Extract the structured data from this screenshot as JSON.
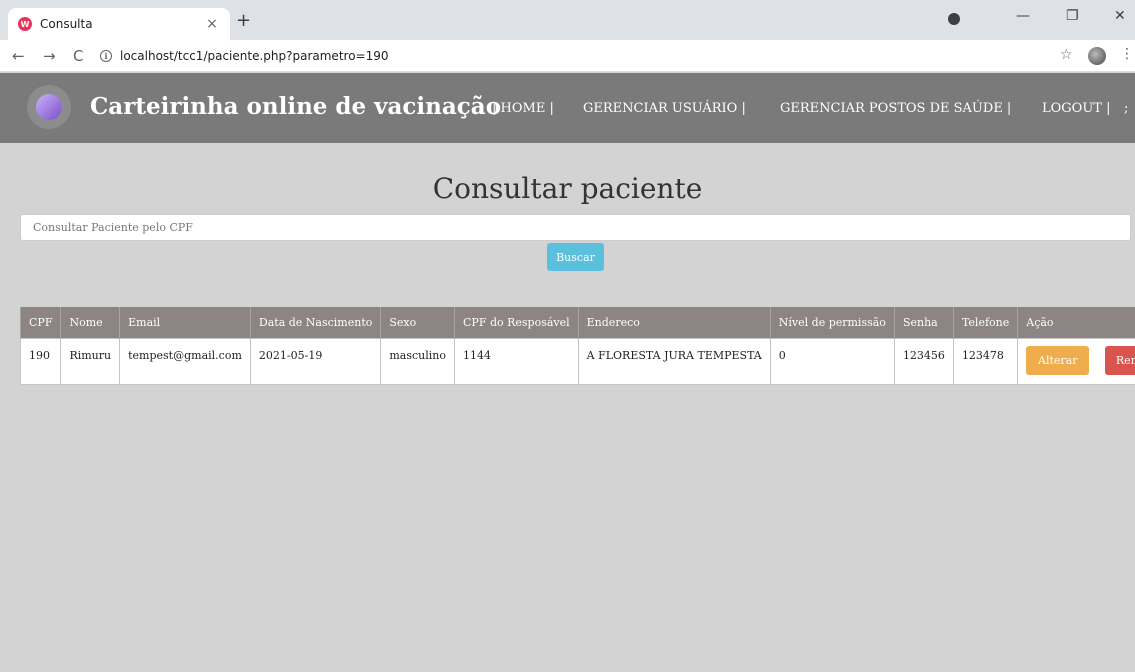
{
  "browser": {
    "tab_title": "Consulta",
    "tab_favicon_glyph": "W",
    "tab_close": "×",
    "new_tab": "+",
    "url": "localhost/tcc1/paciente.php?parametro=190",
    "back": "←",
    "forward": "→",
    "reload": "C",
    "info": "i",
    "star": "☆",
    "menu": "⋮",
    "minimize": "—",
    "restore": "❐",
    "close": "✕"
  },
  "header": {
    "site_title": "Carteirinha online de vacinação",
    "nav": {
      "home": "| HOME |",
      "users": "GERENCIAR USUÁRIO |",
      "posts": "GERENCIAR POSTOS DE SAÚDE |",
      "logout": "LOGOUT |",
      "extra": ";"
    }
  },
  "main": {
    "title": "Consultar paciente",
    "search": {
      "placeholder": "Consultar Paciente pelo CPF",
      "value": ""
    },
    "search_button": "Buscar",
    "table": {
      "columns": [
        "CPF",
        "Nome",
        "Email",
        "Data de Nascimento",
        "Sexo",
        "CPF do Resposável",
        "Endereco",
        "Nível de permissão",
        "Senha",
        "Telefone",
        "Ação"
      ],
      "rows": [
        {
          "cpf": "190",
          "nome": "Rimuru",
          "email": "tempest@gmail.com",
          "nascimento": "2021-05-19",
          "sexo": "masculino",
          "cpf_responsavel": "1144",
          "endereco": "A FLORESTA JURA TEMPESTA",
          "nivel": "0",
          "senha": "123456",
          "telefone": "123478",
          "alterar": "Alterar",
          "remover": "Remover"
        }
      ]
    }
  },
  "colors": {
    "header_bg": "#7a7a7a",
    "page_bg": "#d3d3d3",
    "table_head_bg": "#8c8584",
    "btn_info": "#5bc0de",
    "btn_warning": "#f0ad4e",
    "btn_danger": "#d9534f"
  },
  "icons": {
    "logo": "vaccine-logo-icon",
    "info": "info-icon",
    "star": "bookmark-star-icon",
    "avatar": "profile-avatar"
  }
}
